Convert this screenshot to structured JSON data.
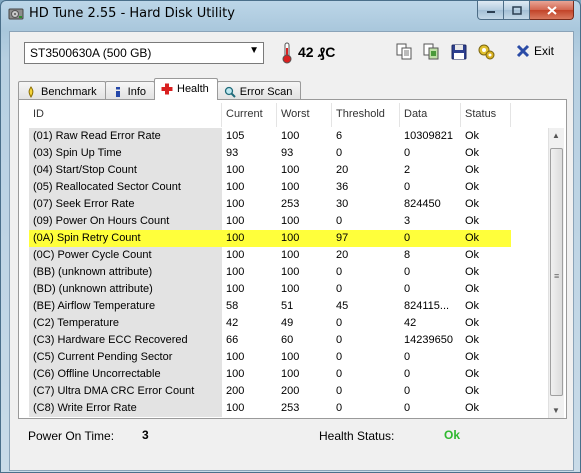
{
  "window": {
    "title": "HD Tune 2.55 - Hard Disk Utility"
  },
  "toolbar": {
    "drive": "ST3500630A (500 GB)",
    "temperature": "42 ₰C",
    "exit_label": "Exit",
    "icons": [
      "copy-text-icon",
      "copy-screenshot-icon",
      "save-icon",
      "options-icon",
      "exit-icon"
    ]
  },
  "tabs": [
    {
      "label": "Benchmark",
      "icon": "benchmark-icon"
    },
    {
      "label": "Info",
      "icon": "info-icon"
    },
    {
      "label": "Health",
      "icon": "health-icon",
      "active": true
    },
    {
      "label": "Error Scan",
      "icon": "error-scan-icon"
    }
  ],
  "table": {
    "headers": [
      "ID",
      "Current",
      "Worst",
      "Threshold",
      "Data",
      "Status"
    ],
    "rows": [
      [
        "(01) Raw Read Error Rate",
        "105",
        "100",
        "6",
        "10309821",
        "Ok"
      ],
      [
        "(03) Spin Up Time",
        "93",
        "93",
        "0",
        "0",
        "Ok"
      ],
      [
        "(04) Start/Stop Count",
        "100",
        "100",
        "20",
        "2",
        "Ok"
      ],
      [
        "(05) Reallocated Sector Count",
        "100",
        "100",
        "36",
        "0",
        "Ok"
      ],
      [
        "(07) Seek Error Rate",
        "100",
        "253",
        "30",
        "824450",
        "Ok"
      ],
      [
        "(09) Power On Hours Count",
        "100",
        "100",
        "0",
        "3",
        "Ok"
      ],
      [
        "(0A) Spin Retry Count",
        "100",
        "100",
        "97",
        "0",
        "Ok"
      ],
      [
        "(0C) Power Cycle Count",
        "100",
        "100",
        "20",
        "8",
        "Ok"
      ],
      [
        "(BB) (unknown attribute)",
        "100",
        "100",
        "0",
        "0",
        "Ok"
      ],
      [
        "(BD) (unknown attribute)",
        "100",
        "100",
        "0",
        "0",
        "Ok"
      ],
      [
        "(BE) Airflow Temperature",
        "58",
        "51",
        "45",
        "824115...",
        "Ok"
      ],
      [
        "(C2) Temperature",
        "42",
        "49",
        "0",
        "42",
        "Ok"
      ],
      [
        "(C3) Hardware ECC Recovered",
        "66",
        "60",
        "0",
        "14239650",
        "Ok"
      ],
      [
        "(C5) Current Pending Sector",
        "100",
        "100",
        "0",
        "0",
        "Ok"
      ],
      [
        "(C6) Offline Uncorrectable",
        "100",
        "100",
        "0",
        "0",
        "Ok"
      ],
      [
        "(C7) Ultra DMA CRC Error Count",
        "200",
        "200",
        "0",
        "0",
        "Ok"
      ],
      [
        "(C8) Write Error Rate",
        "100",
        "253",
        "0",
        "0",
        "Ok"
      ]
    ],
    "highlighted_row": 6,
    "highlight_color": "#ffff3b"
  },
  "status": {
    "power_on_label": "Power On Time:",
    "power_on_value": "3",
    "health_label": "Health Status:",
    "health_value": "Ok",
    "health_color": "#2eb82e"
  }
}
